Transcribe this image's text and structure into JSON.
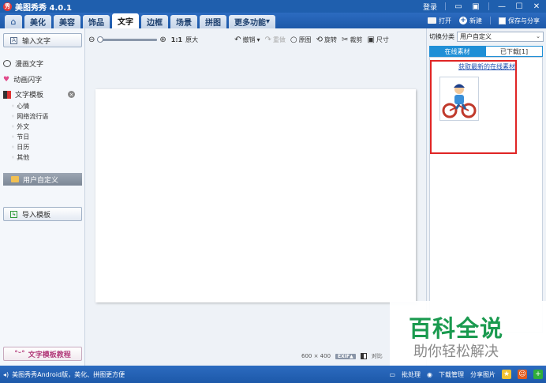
{
  "app": {
    "title": "美图秀秀 4.0.1",
    "logo_text": "秀"
  },
  "titlebar": {
    "login": "登录"
  },
  "nav": {
    "tabs": [
      "美化",
      "美容",
      "饰品",
      "文字",
      "边框",
      "场景",
      "拼图",
      "更多功能"
    ],
    "active": "文字",
    "right": {
      "open": "打开",
      "new": "新建",
      "save": "保存与分享"
    }
  },
  "left": {
    "input_text": "输入文字",
    "comic_text": "漫画文字",
    "animated_text": "动画闪字",
    "template_title": "文字模板",
    "template_items": [
      "心情",
      "网络流行语",
      "外文",
      "节日",
      "日历",
      "其他"
    ],
    "custom": "用户自定义",
    "import_template": "导入模板",
    "tutorial": "文字模板教程"
  },
  "toolbar": {
    "ratio": "1:1",
    "original": "原大",
    "undo": "撤销",
    "redo": "重做",
    "original_image": "原图",
    "rotate": "旋转",
    "crop": "裁剪",
    "size": "尺寸"
  },
  "canvas_info": {
    "dimensions": "600 × 400",
    "exif": "EXIF▲",
    "compare": "对比"
  },
  "right": {
    "category_label": "切换分类",
    "category_value": "用户自定义",
    "tabs": [
      "在线素材",
      "已下载[1]"
    ],
    "active_tab": "已下载[1]",
    "get_link": "获取最新的在线素材"
  },
  "watermark": {
    "title": "百科全说",
    "subtitle": "助你轻松解决"
  },
  "statusbar": {
    "promo": "美图秀秀Android版，美化、拼图更方便",
    "batch": "批处理",
    "downloads": "下载管理",
    "share": "分享图片"
  },
  "colors": {
    "titlebar": "#1f5fae",
    "tab_active": "#1f8fd6",
    "highlight": "#e02525",
    "watermark_green": "#1a9a4f"
  }
}
